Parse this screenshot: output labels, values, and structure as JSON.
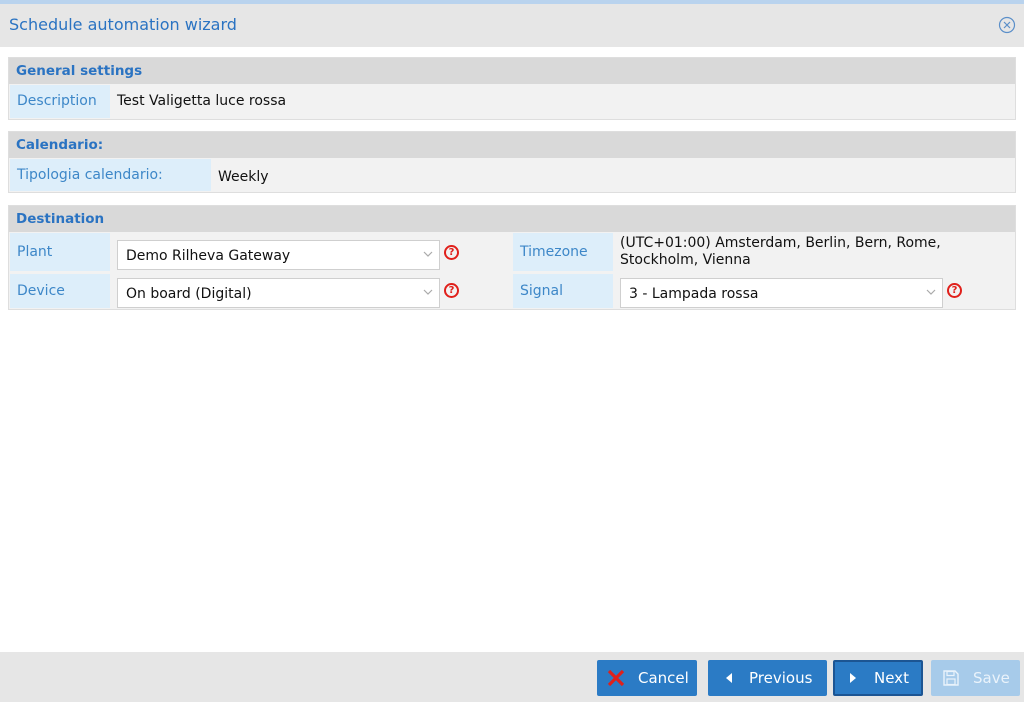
{
  "window": {
    "title": "Schedule automation wizard"
  },
  "general": {
    "header": "General settings",
    "description_label": "Description",
    "description_value": "Test Valigetta luce rossa"
  },
  "calendar": {
    "header": "Calendario:",
    "type_label": "Tipologia calendario:",
    "type_value": "Weekly"
  },
  "destination": {
    "header": "Destination",
    "plant_label": "Plant",
    "plant_value": "Demo Rilheva Gateway",
    "device_label": "Device",
    "device_value": "On board (Digital)",
    "timezone_label": "Timezone",
    "timezone_value_line1": "(UTC+01:00) Amsterdam, Berlin, Bern, Rome,",
    "timezone_value_line2": "Stockholm, Vienna",
    "signal_label": "Signal",
    "signal_value": "3 - Lampada rossa"
  },
  "footer": {
    "cancel_label": "Cancel",
    "previous_label": "Previous",
    "next_label": "Next",
    "save_label": "Save"
  },
  "help_glyph": "?",
  "colors": {
    "accent": "#2b7bc5",
    "label_text": "#3d87c8",
    "cancel_icon": "#e0201b"
  }
}
